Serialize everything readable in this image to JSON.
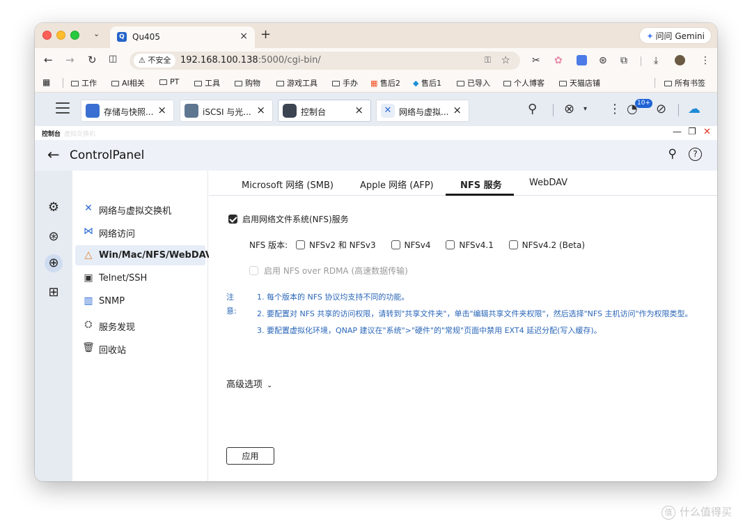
{
  "browser": {
    "tab_title": "Qu405",
    "tab_close": "×",
    "new_tab": "+",
    "gemini_label": "问问 Gemini",
    "insecure_label": "不安全",
    "url_host": "192.168.100.138",
    "url_rest": ":5000/cgi-bin/",
    "bookmarks": [
      "工作",
      "AI相关",
      "PT",
      "工具",
      "购物",
      "游戏工具",
      "手办",
      "售后2",
      "售后1",
      "已导入",
      "个人博客",
      "天猫店铺"
    ],
    "all_bookmarks": "所有书签"
  },
  "nas_tabs": [
    {
      "label": "存储与快照...",
      "close": "×"
    },
    {
      "label": "iSCSI 与光...",
      "close": "×"
    },
    {
      "label": "控制台",
      "close": "×"
    },
    {
      "label": "网络与虚拟...",
      "close": "×"
    }
  ],
  "notification_badge": "10+",
  "window": {
    "title": "控制台",
    "ghost_title": "虚拟交换机",
    "minimize": "—",
    "restore": "❐",
    "close": "✕"
  },
  "header": {
    "title": "ControlPanel",
    "help": "?"
  },
  "submenu": [
    {
      "label": "网络与虚拟交换机",
      "icon": "network-switch-icon"
    },
    {
      "label": "网络访问",
      "icon": "network-access-icon"
    },
    {
      "label": "Win/Mac/NFS/WebDAV",
      "icon": "win-mac-nfs-icon"
    },
    {
      "label": "Telnet/SSH",
      "icon": "terminal-icon"
    },
    {
      "label": "SNMP",
      "icon": "snmp-chart-icon"
    },
    {
      "label": "服务发现",
      "icon": "service-discovery-icon"
    },
    {
      "label": "回收站",
      "icon": "trash-icon"
    }
  ],
  "content_tabs": [
    "Microsoft 网络 (SMB)",
    "Apple 网络 (AFP)",
    "NFS 服务",
    "WebDAV"
  ],
  "nfs": {
    "enable_label": "启用网络文件系统(NFS)服务",
    "version_label": "NFS 版本:",
    "versions": [
      "NFSv2 和 NFSv3",
      "NFSv4",
      "NFSv4.1",
      "NFSv4.2 (Beta)"
    ],
    "rdma_label": "启用 NFS over RDMA (高速数据传输)",
    "note_label": "注意:",
    "notes": [
      "1. 每个版本的 NFS 协议均支持不同的功能。",
      "2. 要配置对 NFS 共享的访问权限，请转到\"共享文件夹\"，单击\"编辑共享文件夹权限\"，然后选择\"NFS 主机访问\"作为权限类型。",
      "3. 要配置虚拟化环境，QNAP 建议在\"系统\">\"硬件\"的\"常规\"页面中禁用 EXT4 延迟分配(写入缓存)。"
    ],
    "advanced_label": "高级选项",
    "apply_label": "应用"
  },
  "watermark": "什么值得买",
  "watermark_glyph": "值",
  "colors": {
    "accent": "#1e63d6",
    "note_text": "#2a66b8"
  }
}
